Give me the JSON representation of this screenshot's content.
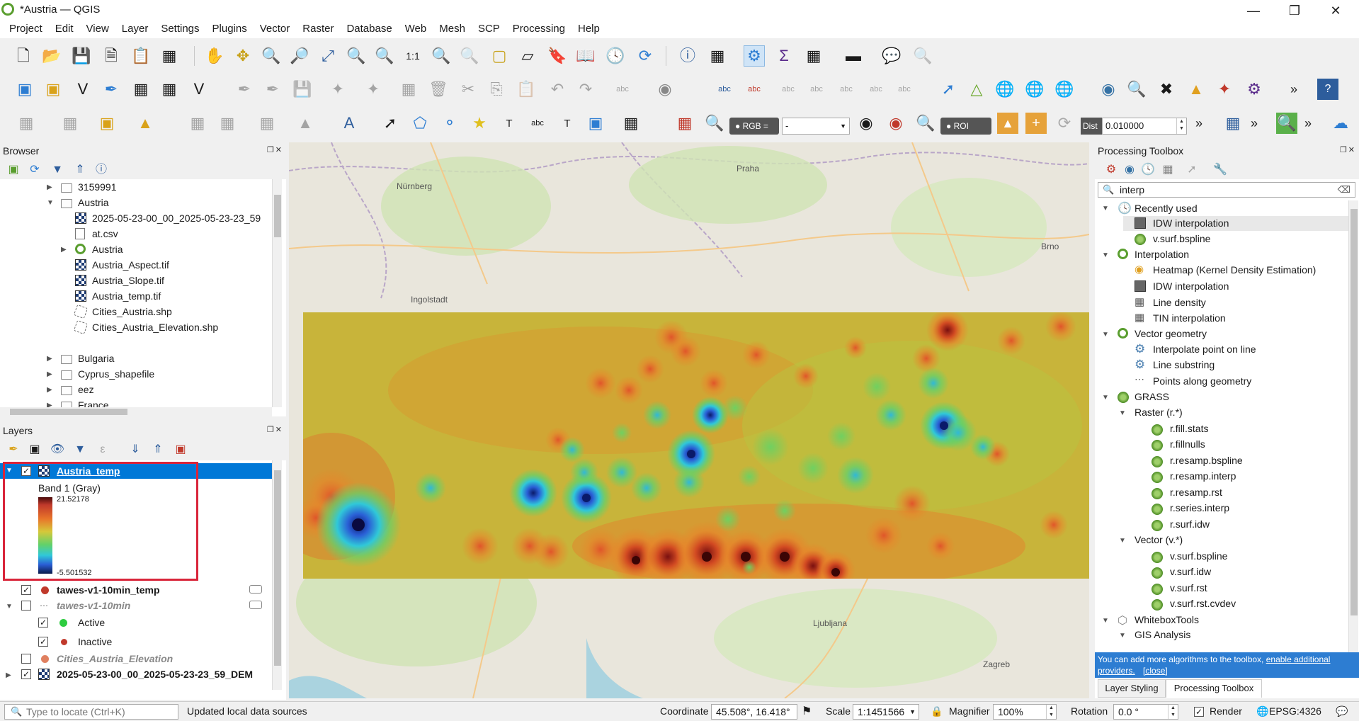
{
  "window": {
    "title": "*Austria — QGIS"
  },
  "menu": [
    "Project",
    "Edit",
    "View",
    "Layer",
    "Settings",
    "Plugins",
    "Vector",
    "Raster",
    "Database",
    "Web",
    "Mesh",
    "SCP",
    "Processing",
    "Help"
  ],
  "toolbar3": {
    "rgb_label": "RGB =",
    "rgb_value": "-",
    "roi_label": "ROI",
    "dist_label": "Dist",
    "dist_value": "0.010000"
  },
  "browser": {
    "title": "Browser",
    "items": [
      {
        "label": "3159991",
        "icon": "folder-icon"
      },
      {
        "label": "Austria",
        "icon": "folder-icon"
      },
      {
        "label": "2025-05-23-00_00_2025-05-23-23_59",
        "icon": "raster-icon"
      },
      {
        "label": "at.csv",
        "icon": "csv-icon"
      },
      {
        "label": "Austria",
        "icon": "qgis-project-icon"
      },
      {
        "label": "Austria_Aspect.tif",
        "icon": "raster-icon"
      },
      {
        "label": "Austria_Slope.tif",
        "icon": "raster-icon"
      },
      {
        "label": "Austria_temp.tif",
        "icon": "raster-icon"
      },
      {
        "label": "Cities_Austria.shp",
        "icon": "vector-icon"
      },
      {
        "label": "Cities_Austria_Elevation.shp",
        "icon": "vector-icon"
      },
      {
        "label": "Bulgaria",
        "icon": "folder-icon"
      },
      {
        "label": "Cyprus_shapefile",
        "icon": "folder-icon"
      },
      {
        "label": "eez",
        "icon": "folder-icon"
      },
      {
        "label": "France",
        "icon": "folder-icon"
      }
    ]
  },
  "layers": {
    "title": "Layers",
    "selected_layer": "Austria_temp",
    "band": "Band 1 (Gray)",
    "legend_max": "21.52178",
    "legend_min": "-5.501532",
    "items": [
      {
        "label": "tawes-v1-10min_temp",
        "checked": true
      },
      {
        "label": "tawes-v1-10min",
        "checked": false
      },
      {
        "label": "Active",
        "checked": true
      },
      {
        "label": "Inactive",
        "checked": true
      },
      {
        "label": "Cities_Austria_Elevation",
        "checked": false
      },
      {
        "label": "2025-05-23-00_00_2025-05-23-23_59_DEM",
        "checked": true
      }
    ]
  },
  "map": {
    "labels": [
      "Nürnberg",
      "Praha",
      "Brno",
      "Ingolstadt",
      "Ljubljana",
      "Zagreb"
    ],
    "colors": {
      "hot": "#c0392b",
      "mid": "#c8b43a",
      "cold": "#2a5fd6"
    }
  },
  "toolbox": {
    "title": "Processing Toolbox",
    "search_value": "interp",
    "groups": {
      "recent": "Recently used",
      "recent_items": [
        "IDW interpolation",
        "v.surf.bspline"
      ],
      "interpolation": "Interpolation",
      "interpolation_items": [
        "Heatmap (Kernel Density Estimation)",
        "IDW interpolation",
        "Line density",
        "TIN interpolation"
      ],
      "vector_geometry": "Vector geometry",
      "vector_geometry_items": [
        "Interpolate point on line",
        "Line substring",
        "Points along geometry"
      ],
      "grass": "GRASS",
      "raster": "Raster (r.*)",
      "raster_items": [
        "r.fill.stats",
        "r.fillnulls",
        "r.resamp.bspline",
        "r.resamp.interp",
        "r.resamp.rst",
        "r.series.interp",
        "r.surf.idw"
      ],
      "vector": "Vector (v.*)",
      "vector_items": [
        "v.surf.bspline",
        "v.surf.idw",
        "v.surf.rst",
        "v.surf.rst.cvdev"
      ],
      "whitebox": "WhiteboxTools",
      "gis": "GIS Analysis"
    },
    "info_text": "You can add more algorithms to the toolbox,",
    "info_link": "enable additional",
    "info_link2": "providers.",
    "info_close": "[close]",
    "tabs": [
      "Layer Styling",
      "Processing Toolbox"
    ]
  },
  "status": {
    "locate_placeholder": "Type to locate (Ctrl+K)",
    "message": "Updated local data sources",
    "coordinate_label": "Coordinate",
    "coordinate": "45.508°, 16.418°",
    "scale_label": "Scale",
    "scale": "1:1451566",
    "magnifier_label": "Magnifier",
    "magnifier": "100%",
    "rotation_label": "Rotation",
    "rotation": "0.0 °",
    "render_label": "Render",
    "crs": "EPSG:4326"
  }
}
